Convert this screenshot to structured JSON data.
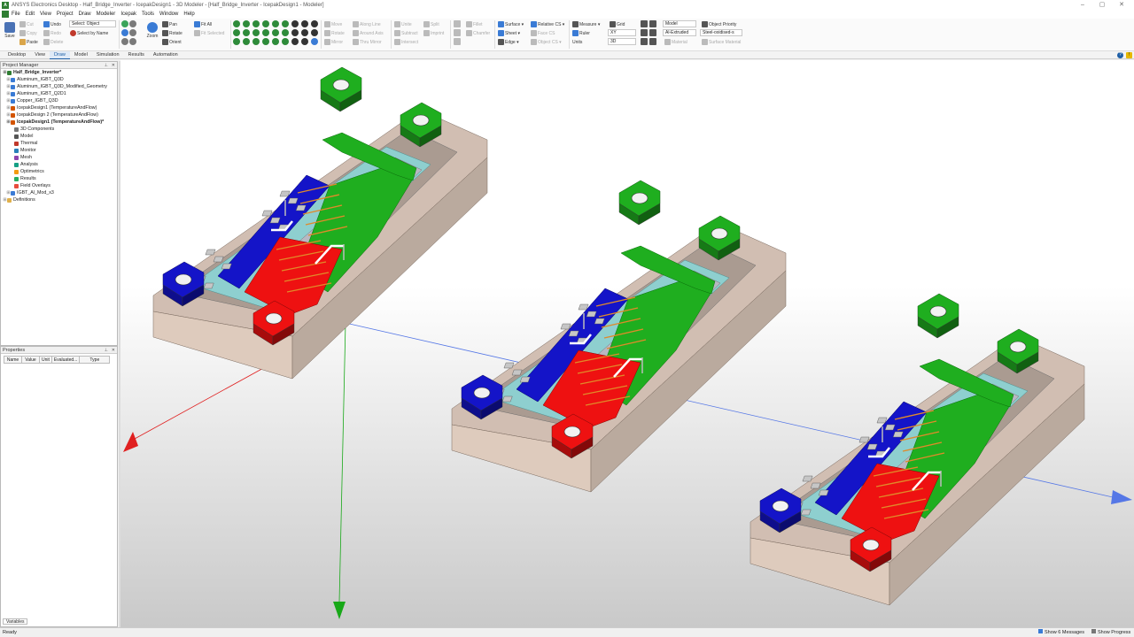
{
  "window": {
    "title": "ANSYS Electronics Desktop - Half_Bridge_Inverter - IcepakDesign1 - 3D Modeler - [Half_Bridge_Inverter - IcepakDesign1 - Modeler]",
    "app_icon": "ansys-logo-icon",
    "controls": [
      "–",
      "▢",
      "✕"
    ]
  },
  "menubar": {
    "items": [
      "File",
      "Edit",
      "View",
      "Project",
      "Draw",
      "Modeler",
      "Icepak",
      "Tools",
      "Window",
      "Help"
    ]
  },
  "ribbon": {
    "save": "Save",
    "cut": "Cut",
    "copy": "Copy",
    "paste": "Paste",
    "undo": "Undo",
    "redo": "Redo",
    "delete": "Delete",
    "select_object": "Select: Object",
    "select_by_name": "Select by Name",
    "zoom": "Zoom",
    "pan": "Pan",
    "rotate": "Rotate",
    "orient": "Orient",
    "fit_all": "Fit All",
    "fit_selected": "Fit Selected",
    "move": "Move",
    "rotate2": "Rotate",
    "mirror": "Mirror",
    "along_line": "Along Line",
    "around_axis": "Around Axis",
    "thru_mirror": "Thru Mirror",
    "unite": "Unite",
    "subtract": "Subtract",
    "intersect": "Intersect",
    "split": "Split",
    "imprint": "Imprint",
    "fillet": "Fillet",
    "chamfer": "Chamfer",
    "surface": "Surface",
    "sheet": "Sheet",
    "edge": "Edge",
    "relative_cs": "Relative CS",
    "face_cs": "Face CS",
    "object_cs": "Object CS",
    "measure": "Measure",
    "ruler": "Ruler",
    "units": "Units",
    "grid": "Grid",
    "grid_plane": "XY",
    "grid_mode": "3D",
    "model_select": "Model",
    "material_select": "Al-Extruded",
    "material": "Material",
    "object_priority": "Object Priority",
    "surface_material_select": "Steel-oxidised-s",
    "surface_material": "Surface Material"
  },
  "tabs": [
    "Desktop",
    "View",
    "Draw",
    "Model",
    "Simulation",
    "Results",
    "Automation"
  ],
  "active_tab": "Draw",
  "project_manager": {
    "title": "Project Manager",
    "items": [
      {
        "label": "Half_Bridge_Inverter*",
        "depth": 0,
        "icon": "project-icon",
        "bold": true
      },
      {
        "label": "Aluminum_IGBT_Q3D",
        "depth": 1,
        "icon": "q3d-design-icon"
      },
      {
        "label": "Aluminum_IGBT_Q3D_Modified_Geometry",
        "depth": 1,
        "icon": "q3d-design-icon"
      },
      {
        "label": "Aluminum_IGBT_Q2D1",
        "depth": 1,
        "icon": "q3d-design-icon"
      },
      {
        "label": "Copper_IGBT_Q3D",
        "depth": 1,
        "icon": "q3d-design-icon"
      },
      {
        "label": "IcepakDesign1 (TemperatureAndFlow)",
        "depth": 1,
        "icon": "icepak-design-icon"
      },
      {
        "label": "IcepakDesign 2 (TemperatureAndFlow)",
        "depth": 1,
        "icon": "icepak-design-icon"
      },
      {
        "label": "IcepakDesign1 (TemperatureAndFlow)*",
        "depth": 1,
        "icon": "icepak-design-icon",
        "bold": true
      },
      {
        "label": "3D Components",
        "depth": 2,
        "icon": "components-icon"
      },
      {
        "label": "Model",
        "depth": 2,
        "icon": "model-icon"
      },
      {
        "label": "Thermal",
        "depth": 2,
        "icon": "thermal-icon"
      },
      {
        "label": "Monitor",
        "depth": 2,
        "icon": "monitor-icon"
      },
      {
        "label": "Mesh",
        "depth": 2,
        "icon": "mesh-icon"
      },
      {
        "label": "Analysis",
        "depth": 2,
        "icon": "analysis-icon"
      },
      {
        "label": "Optimetrics",
        "depth": 2,
        "icon": "optimetrics-icon"
      },
      {
        "label": "Results",
        "depth": 2,
        "icon": "results-icon"
      },
      {
        "label": "Field Overlays",
        "depth": 2,
        "icon": "field-overlays-icon"
      },
      {
        "label": "IGBT_Al_Mod_x3",
        "depth": 1,
        "icon": "q3d-design-icon"
      },
      {
        "label": "Definitions",
        "depth": 0,
        "icon": "folder-icon"
      }
    ]
  },
  "properties": {
    "title": "Properties",
    "columns": [
      "Name",
      "Value",
      "Unit",
      "Evaluated...",
      "Type"
    ],
    "variables_tab": "Variables"
  },
  "statusbar": {
    "left": "Ready",
    "messages": "Show 6 Messages",
    "progress": "Show Progress"
  },
  "colors": {
    "substrate": "#e3cfc1",
    "green": "#1fae1f",
    "blue": "#1414c8",
    "red": "#ee1111",
    "teal": "#8ecfcf",
    "grey": "#b8b8c2",
    "orange": "#e08a2a",
    "axis_x": "#5577e6",
    "axis_y": "#18a818",
    "axis_z": "#e02020"
  }
}
